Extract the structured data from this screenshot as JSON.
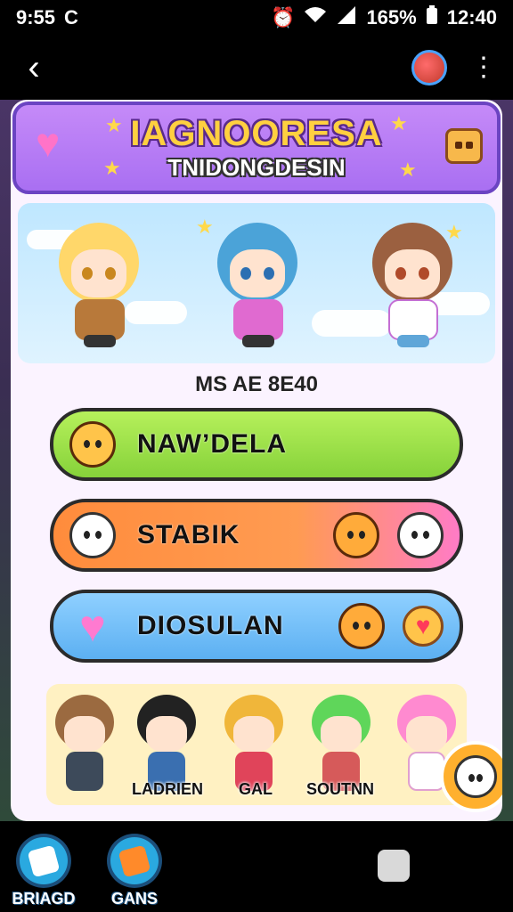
{
  "status_bar": {
    "time_left": "9:55",
    "c_icon": "C",
    "battery_percent": "165%",
    "time_right": "12:40"
  },
  "header": {
    "title": "IAGNOORESA",
    "subtitle": "TNIDONGDESIN"
  },
  "section_label": "MS AE 8E40",
  "menu": [
    {
      "label": "NAW’DELA",
      "color": "#9be64a"
    },
    {
      "label": "STABIK",
      "color": "#ff8c3c"
    },
    {
      "label": "DIOSULAN",
      "color": "#6cbcf5"
    }
  ],
  "roster": {
    "labels": [
      "LADRIEN",
      "GAL",
      "SOUTNN"
    ]
  },
  "bottom_nav": [
    {
      "label": "BRIAGD",
      "icon": "cube-icon"
    },
    {
      "label": "GANS",
      "icon": "box-icon"
    }
  ]
}
